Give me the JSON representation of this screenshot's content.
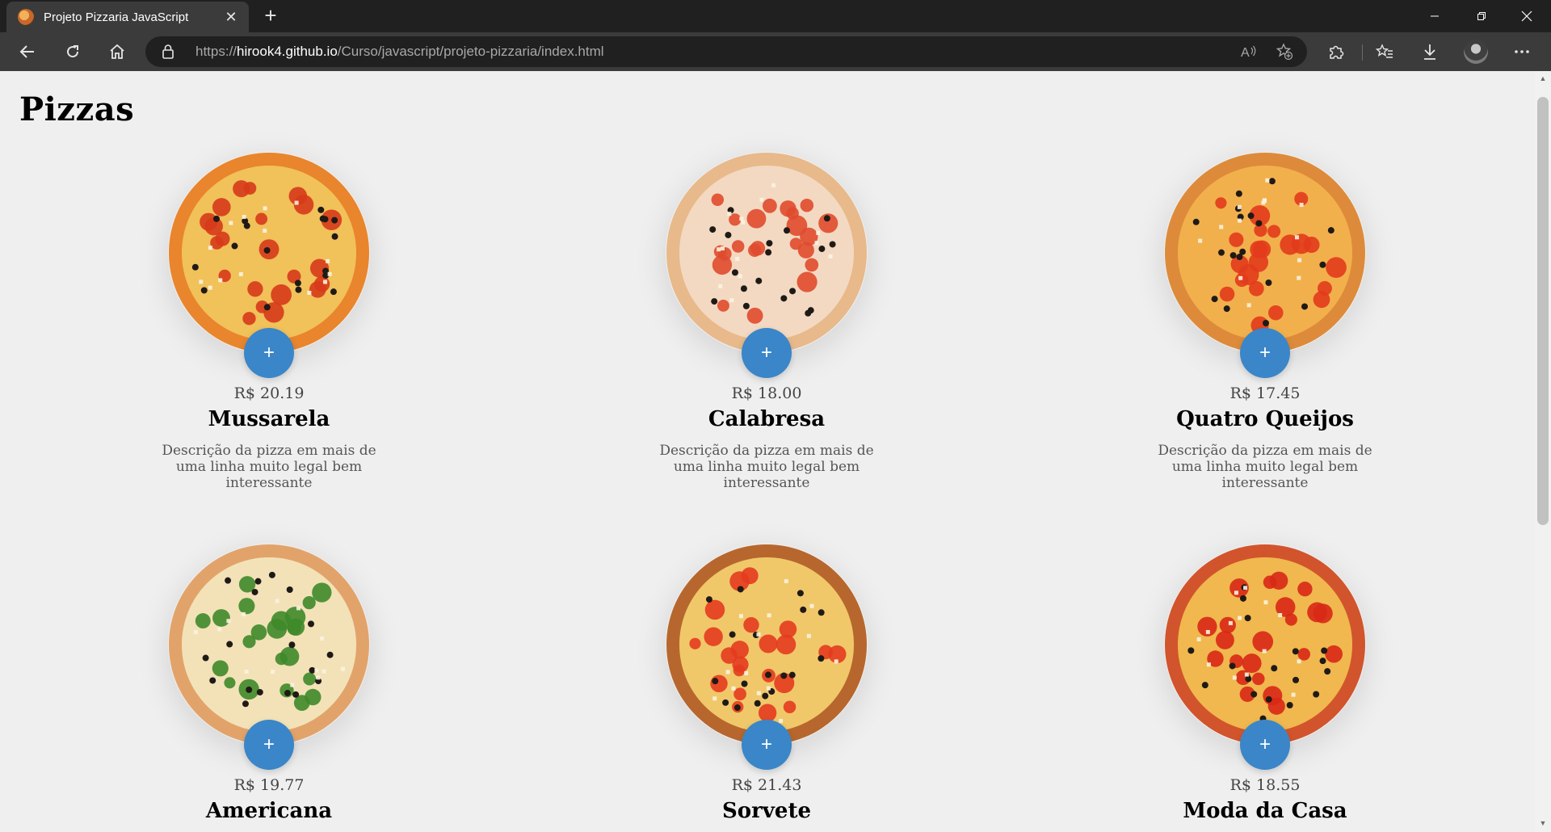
{
  "browser": {
    "tab_title": "Projeto Pizzaria JavaScript",
    "tab_close": "✕",
    "new_tab": "+",
    "url_scheme": "https://",
    "url_host": "hirook4.github.io",
    "url_path": "/Curso/javascript/projeto-pizzaria/index.html",
    "controls": {
      "minimize": "minimize-icon",
      "restore": "restore-icon",
      "close": "close-icon"
    },
    "icons": [
      "back-icon",
      "refresh-icon",
      "home-icon",
      "lock-icon",
      "read-aloud-icon",
      "add-favorite-icon",
      "extensions-icon",
      "favorites-icon",
      "downloads-icon",
      "profile-avatar",
      "more-icon"
    ]
  },
  "page": {
    "title": "Pizzas"
  },
  "pizzas": [
    {
      "price": "R$ 20.19",
      "name": "Mussarela",
      "description": "Descrição da pizza em mais de uma linha muito legal bem interessante",
      "add_label": "+",
      "crust": "#e9852c",
      "topping": "#d63a1a",
      "cheese": "#f1c15a"
    },
    {
      "price": "R$ 18.00",
      "name": "Calabresa",
      "description": "Descrição da pizza em mais de uma linha muito legal bem interessante",
      "add_label": "+",
      "crust": "#e8b98a",
      "topping": "#e04a2e",
      "cheese": "#f3d9c2"
    },
    {
      "price": "R$ 17.45",
      "name": "Quatro Queijos",
      "description": "Descrição da pizza em mais de uma linha muito legal bem interessante",
      "add_label": "+",
      "crust": "#dd8b3a",
      "topping": "#e23b1c",
      "cheese": "#f2b04c"
    },
    {
      "price": "R$ 19.77",
      "name": "Americana",
      "description": "",
      "add_label": "+",
      "crust": "#e2a36a",
      "topping": "#3f8a2a",
      "cheese": "#f3e2b8"
    },
    {
      "price": "R$ 21.43",
      "name": "Sorvete",
      "description": "",
      "add_label": "+",
      "crust": "#b7672d",
      "topping": "#e43b1f",
      "cheese": "#f0c86a"
    },
    {
      "price": "R$ 18.55",
      "name": "Moda da Casa",
      "description": "",
      "add_label": "+",
      "crust": "#d2542c",
      "topping": "#d82817",
      "cheese": "#f0b84e"
    }
  ]
}
